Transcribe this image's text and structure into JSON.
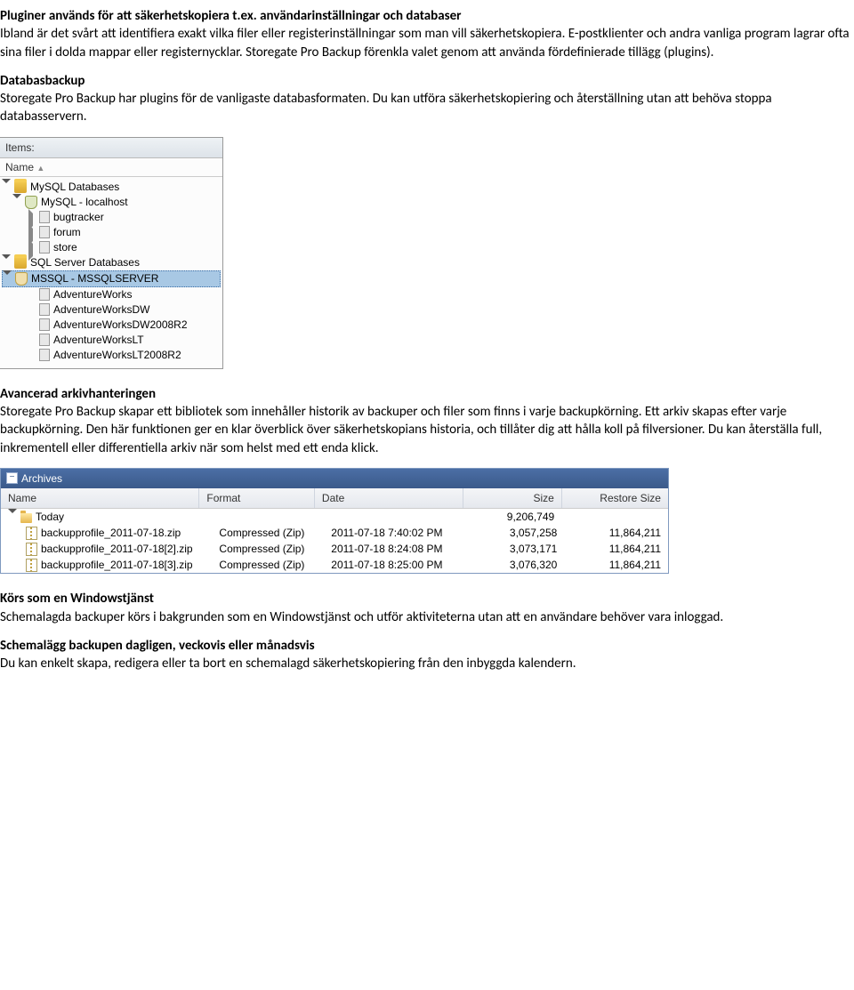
{
  "doc": {
    "h1_a": "Pluginer används för att säkerhetskopiera t.ex. användarinställningar och databaser",
    "p1": "Ibland är det svårt att identifiera exakt vilka filer eller registerinställningar som man vill säkerhetskopiera. E-postklienter och andra vanliga program lagrar ofta sina filer i dolda mappar eller registernycklar. Storegate Pro Backup förenkla valet genom att använda fördefinierade tillägg (plugins).",
    "h2": "Databasbackup",
    "p2": "Storegate Pro Backup har plugins för de vanligaste databasformaten. Du kan utföra säkerhetskopiering och återställning utan att behöva stoppa databasservern.",
    "h3": "Avancerad arkivhanteringen",
    "p3": "Storegate Pro Backup skapar ett bibliotek som innehåller historik av backuper och filer som finns i varje backupkörning. Ett arkiv skapas efter varje backupkörning. Den här funktionen ger en klar överblick över säkerhetskopians historia, och tillåter dig att hålla koll på filversioner. Du kan återställa full, inkrementell eller differentiella arkiv när som helst med ett enda klick.",
    "h4": "Körs som en Windowstjänst",
    "p4": "Schemalagda backuper körs i bakgrunden som en Windowstjänst och utför aktiviteterna utan att en användare behöver vara inloggad.",
    "h5": "Schemalägg backupen dagligen, veckovis eller månadsvis",
    "p5": "Du kan enkelt skapa, redigera eller ta bort en schemalagd säkerhetskopiering från den inbyggda kalendern."
  },
  "items_panel": {
    "header": "Items:",
    "col_name": "Name",
    "sort_arrow": "▲",
    "tree": {
      "mysql_cat": "MySQL Databases",
      "mysql_conn": "MySQL - localhost",
      "mysql_dbs": [
        "bugtracker",
        "forum",
        "store"
      ],
      "sql_cat": "SQL Server Databases",
      "sql_conn": "MSSQL - MSSQLSERVER",
      "sql_dbs": [
        "AdventureWorks",
        "AdventureWorksDW",
        "AdventureWorksDW2008R2",
        "AdventureWorksLT",
        "AdventureWorksLT2008R2"
      ]
    }
  },
  "archives_panel": {
    "title": "Archives",
    "cols": {
      "name": "Name",
      "format": "Format",
      "date": "Date",
      "size": "Size",
      "rsize": "Restore Size"
    },
    "group_row": {
      "name": "Today",
      "size": "9,206,749"
    },
    "rows": [
      {
        "name": "backupprofile_2011-07-18.zip",
        "format": "Compressed (Zip)",
        "date": "2011-07-18 7:40:02 PM",
        "size": "3,057,258",
        "rsize": "11,864,211"
      },
      {
        "name": "backupprofile_2011-07-18[2].zip",
        "format": "Compressed (Zip)",
        "date": "2011-07-18 8:24:08 PM",
        "size": "3,073,171",
        "rsize": "11,864,211"
      },
      {
        "name": "backupprofile_2011-07-18[3].zip",
        "format": "Compressed (Zip)",
        "date": "2011-07-18 8:25:00 PM",
        "size": "3,076,320",
        "rsize": "11,864,211"
      }
    ]
  }
}
